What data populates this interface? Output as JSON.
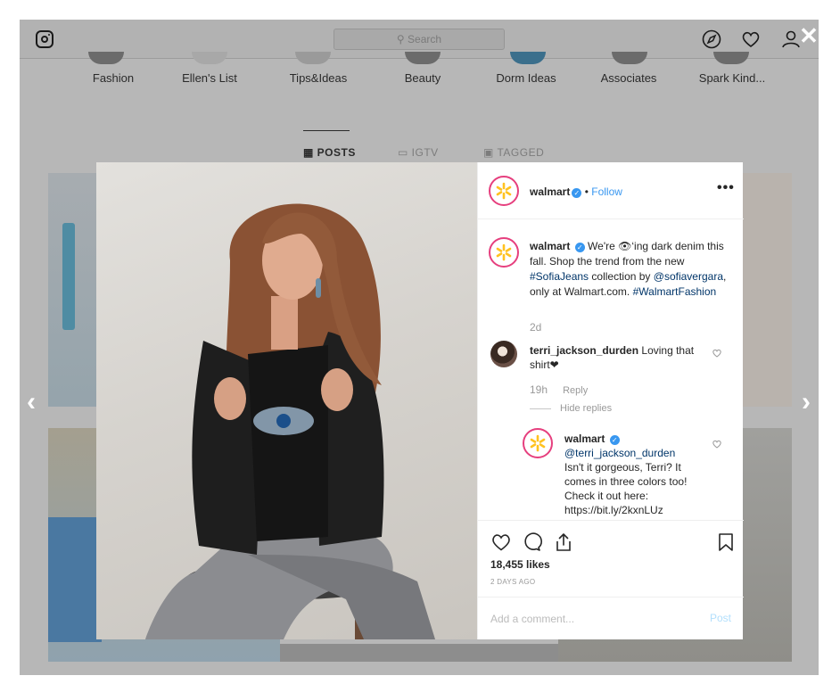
{
  "colors": {
    "accent": "#3897f0",
    "link": "#003569",
    "muted": "#999999",
    "brand_yellow": "#ffc220",
    "story_ring": "#e63f7e"
  },
  "background_page": {
    "search_placeholder": "Search",
    "highlights": [
      "Fashion",
      "Ellen's List",
      "Tips&Ideas",
      "Beauty",
      "Dorm Ideas",
      "Associates",
      "Spark Kind..."
    ],
    "tabs": [
      {
        "label": "POSTS",
        "icon": "grid-icon"
      },
      {
        "label": "IGTV",
        "icon": "igtv-icon"
      },
      {
        "label": "TAGGED",
        "icon": "tag-icon"
      }
    ],
    "prev_arrow": "‹",
    "next_arrow": "›",
    "close": "✕"
  },
  "post": {
    "author": "walmart",
    "follow_label": "Follow",
    "more_label": "•••",
    "caption": {
      "username": "walmart",
      "text_1": "We're 👁‘ing dark denim this fall. Shop the trend from the new",
      "hashtag_1": "#SofiaJeans",
      "text_2": "collection by",
      "mention": "@sofiavergara",
      "text_3": ", only at Walmart.com.",
      "hashtag_2": "#WalmartFashion",
      "time": "2d"
    },
    "comments": [
      {
        "username": "terri_jackson_durden",
        "text": "Loving that shirt❤",
        "time": "19h",
        "reply_label": "Reply",
        "hide_replies_label": "Hide replies",
        "replies": [
          {
            "username": "walmart",
            "mention": "@terri_jackson_durden",
            "text": "Isn't it gorgeous, Terri? It comes in three colors too! Check it out here: https://bit.ly/2kxnLUz"
          }
        ]
      }
    ],
    "likes": "18,455 likes",
    "date": "2 DAYS AGO",
    "comment_placeholder": "Add a comment...",
    "post_button": "Post"
  }
}
